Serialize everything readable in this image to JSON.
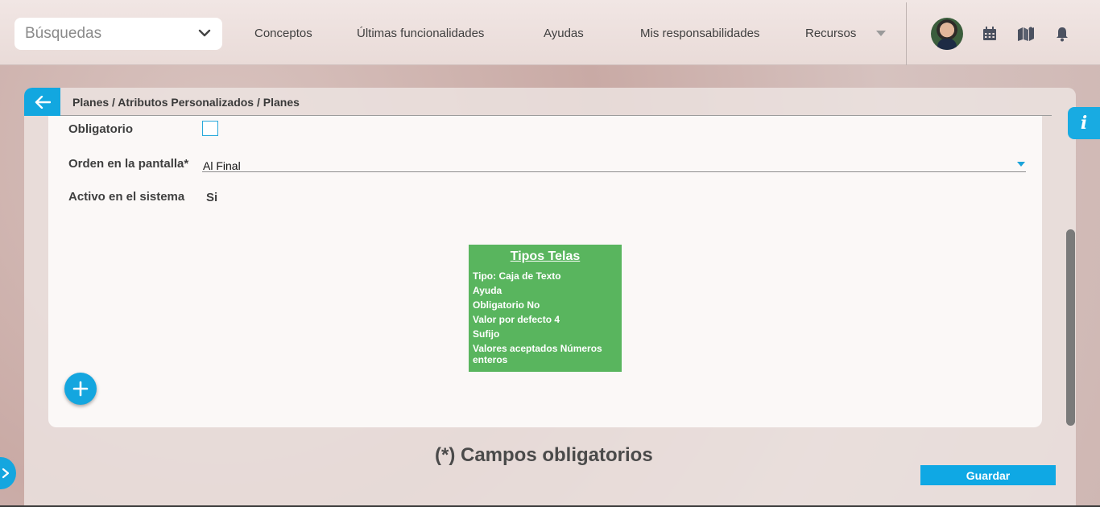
{
  "header": {
    "search": {
      "value": "Búsquedas"
    },
    "nav": [
      "Conceptos",
      "Últimas funcionalidades",
      "Ayudas",
      "Mis responsabilidades",
      "Recursos"
    ]
  },
  "breadcrumb": "Planes / Atributos Personalizados / Planes",
  "form": {
    "obligatorio_label": "Obligatorio",
    "orden_label": "Orden en la pantalla*",
    "orden_value": "Al Final",
    "activo_label": "Activo en el sistema",
    "activo_value": "Si"
  },
  "preview_card": {
    "title": "Tipos Telas",
    "lines": [
      "Tipo: Caja de Texto",
      "Ayuda",
      "Obligatorio No",
      "Valor por defecto 4",
      "Sufijo",
      "Valores aceptados Números enteros"
    ]
  },
  "required_note": "(*) Campos obligatorios",
  "save_label": "Guardar",
  "info_label": "i",
  "colors": {
    "accent": "#14a6df",
    "card_green": "#59b55e"
  }
}
